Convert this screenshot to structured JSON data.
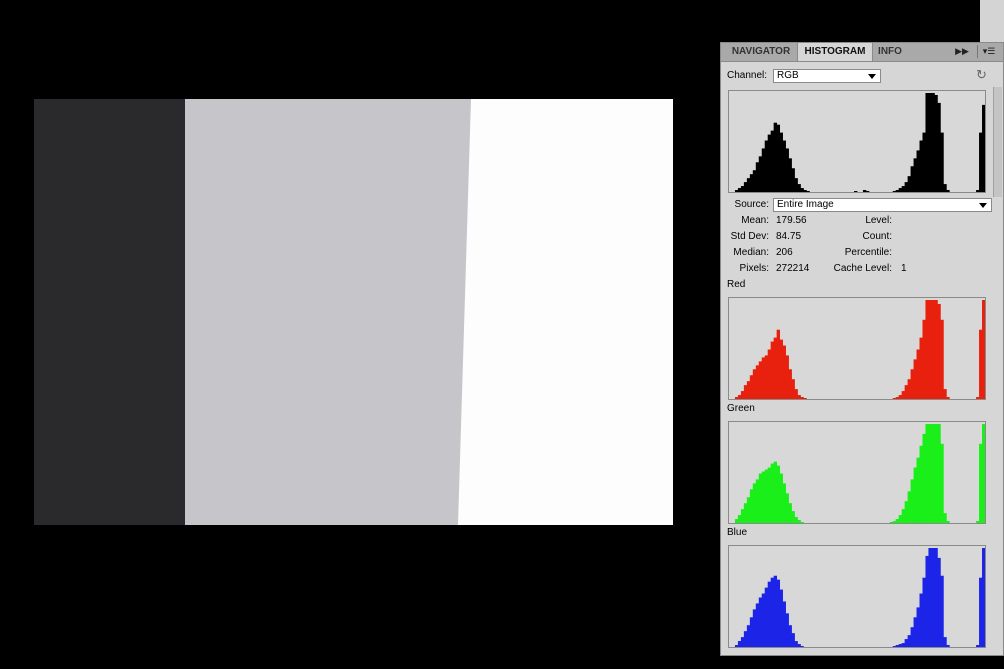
{
  "panel": {
    "tabs": [
      {
        "label": "NAVIGATOR",
        "active": false
      },
      {
        "label": "HISTOGRAM",
        "active": true
      },
      {
        "label": "INFO",
        "active": false
      }
    ],
    "expand_icon": "double-arrow-right-icon",
    "menu_icon": "panel-menu-icon"
  },
  "channel": {
    "label": "Channel:",
    "value": "RGB"
  },
  "refresh_icon": "refresh-icon",
  "source": {
    "label": "Source:",
    "value": "Entire Image"
  },
  "stats": {
    "mean_label": "Mean:",
    "mean": "179.56",
    "std_label": "Std Dev:",
    "std": "84.75",
    "median_label": "Median:",
    "median": "206",
    "pixels_label": "Pixels:",
    "pixels": "272214",
    "level_label": "Level:",
    "level": "",
    "count_label": "Count:",
    "count": "",
    "percentile_label": "Percentile:",
    "percentile": "",
    "cache_label": "Cache Level:",
    "cache": "1"
  },
  "channels": {
    "red_label": "Red",
    "green_label": "Green",
    "blue_label": "Blue"
  },
  "colors": {
    "composite": "#000000",
    "red": "#e8200e",
    "green": "#1aef1a",
    "blue": "#1c24e8",
    "photo_dark": "#2a2a2d",
    "photo_gray": "#c6c5ca",
    "photo_white": "#fdfdfd"
  },
  "chart_data": [
    {
      "type": "area",
      "series": [
        {
          "values": [
            0,
            0,
            2,
            4,
            6,
            10,
            14,
            18,
            22,
            30,
            36,
            44,
            52,
            58,
            62,
            70,
            68,
            60,
            52,
            44,
            34,
            24,
            14,
            8,
            4,
            2,
            1,
            0,
            0,
            0,
            0,
            0,
            0,
            0,
            0,
            0,
            0,
            0,
            0,
            0,
            0,
            0,
            1,
            0,
            0,
            2,
            1,
            0,
            0,
            0,
            0,
            0,
            0,
            0,
            0,
            1,
            2,
            4,
            6,
            10,
            16,
            26,
            34,
            42,
            52,
            60,
            100,
            100,
            100,
            98,
            90,
            60,
            8,
            2,
            0,
            0,
            0,
            0,
            0,
            0,
            0,
            0,
            0,
            2,
            60,
            88
          ]
        }
      ],
      "ylim": [
        0,
        100
      ]
    },
    {
      "type": "area",
      "series": [
        {
          "values": [
            0,
            0,
            2,
            4,
            8,
            14,
            18,
            24,
            30,
            34,
            38,
            42,
            44,
            50,
            58,
            62,
            70,
            60,
            54,
            44,
            30,
            20,
            10,
            4,
            2,
            1,
            0,
            0,
            0,
            0,
            0,
            0,
            0,
            0,
            0,
            0,
            0,
            0,
            0,
            0,
            0,
            0,
            0,
            0,
            0,
            0,
            0,
            0,
            0,
            0,
            0,
            0,
            0,
            0,
            0,
            1,
            2,
            4,
            8,
            14,
            20,
            30,
            40,
            50,
            62,
            80,
            100,
            100,
            100,
            100,
            96,
            80,
            10,
            2,
            0,
            0,
            0,
            0,
            0,
            0,
            0,
            0,
            0,
            2,
            70,
            100
          ]
        }
      ],
      "ylim": [
        0,
        100
      ]
    },
    {
      "type": "area",
      "series": [
        {
          "values": [
            0,
            0,
            4,
            8,
            14,
            20,
            26,
            34,
            40,
            44,
            50,
            52,
            54,
            56,
            60,
            62,
            58,
            50,
            40,
            30,
            20,
            12,
            6,
            3,
            1,
            0,
            0,
            0,
            0,
            0,
            0,
            0,
            0,
            0,
            0,
            0,
            0,
            0,
            0,
            0,
            0,
            0,
            0,
            0,
            0,
            0,
            0,
            0,
            0,
            0,
            0,
            0,
            0,
            0,
            1,
            2,
            4,
            8,
            14,
            22,
            32,
            44,
            56,
            66,
            78,
            90,
            100,
            100,
            100,
            100,
            100,
            80,
            10,
            2,
            0,
            0,
            0,
            0,
            0,
            0,
            0,
            0,
            0,
            2,
            80,
            100
          ]
        }
      ],
      "ylim": [
        0,
        100
      ]
    },
    {
      "type": "area",
      "series": [
        {
          "values": [
            0,
            0,
            2,
            6,
            10,
            16,
            22,
            30,
            38,
            44,
            50,
            54,
            60,
            66,
            70,
            72,
            68,
            58,
            46,
            34,
            22,
            14,
            6,
            3,
            1,
            0,
            0,
            0,
            0,
            0,
            0,
            0,
            0,
            0,
            0,
            0,
            0,
            0,
            0,
            0,
            0,
            0,
            0,
            0,
            0,
            0,
            0,
            0,
            0,
            0,
            0,
            0,
            0,
            0,
            0,
            1,
            2,
            3,
            4,
            8,
            12,
            20,
            30,
            40,
            54,
            70,
            92,
            100,
            100,
            100,
            90,
            72,
            10,
            2,
            0,
            0,
            0,
            0,
            0,
            0,
            0,
            0,
            0,
            2,
            70,
            100
          ]
        }
      ],
      "ylim": [
        0,
        100
      ]
    }
  ]
}
